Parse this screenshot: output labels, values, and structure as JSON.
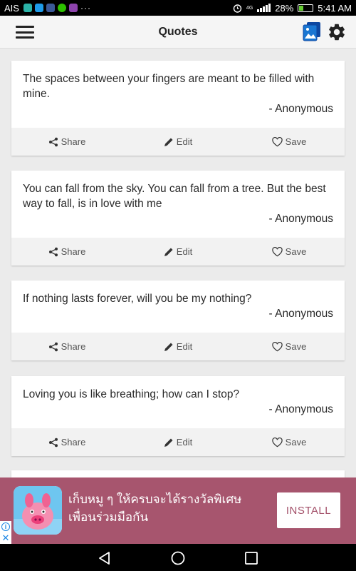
{
  "status_bar": {
    "carrier": "AIS",
    "network": "4G",
    "battery": "28%",
    "time": "5:41 AM",
    "overflow": "···",
    "notification_icons": [
      "mail-app-icon",
      "chat-app-icon",
      "facebook-icon",
      "line-icon",
      "messenger-icon"
    ]
  },
  "app_bar": {
    "title": "Quotes",
    "icons": [
      "menu-icon",
      "gallery-icon",
      "gear-icon"
    ]
  },
  "quotes": [
    {
      "text": "The spaces between your fingers are meant to be filled with mine.",
      "author": "- Anonymous"
    },
    {
      "text": "You can fall from the sky. You can fall from a tree. But the best way to fall, is in love with me",
      "author": "- Anonymous"
    },
    {
      "text": "If nothing lasts forever, will you be my nothing?",
      "author": "- Anonymous"
    },
    {
      "text": "Loving you is like breathing; how can I stop?",
      "author": "- Anonymous"
    }
  ],
  "actions": {
    "share": "Share",
    "edit": "Edit",
    "save": "Save"
  },
  "ad": {
    "text": "เก็บหมู ๆ ให้ครบจะได้รางวัลพิเศษ เพื่อนร่วมมือกัน",
    "install_label": "INSTALL",
    "info_glyph": "i",
    "close_glyph": "✕"
  },
  "colors": {
    "ad_background": "#a7556e",
    "accent_blue": "#1565c0",
    "page_background": "#ebebeb"
  }
}
